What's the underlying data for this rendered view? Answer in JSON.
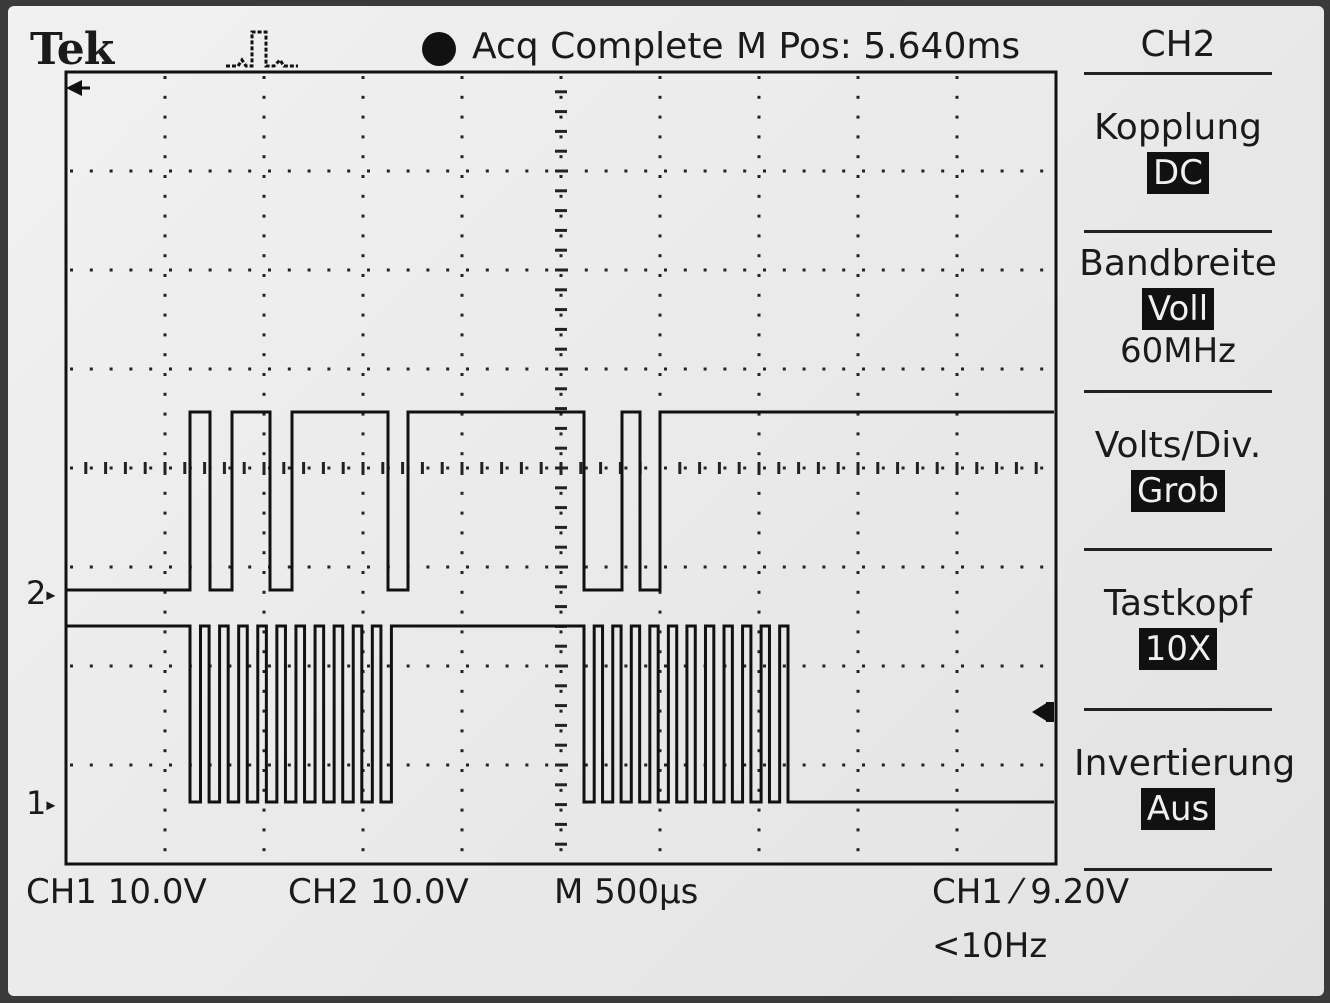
{
  "header": {
    "brand": "Tek",
    "trigger_icon": "pulse-trigger-icon",
    "acq_indicator": "filled-circle-icon",
    "status": "Acq Complete",
    "position": "M Pos: 5.640ms"
  },
  "menu": {
    "title": "CH2",
    "items": [
      {
        "label": "Kopplung",
        "value": "DC"
      },
      {
        "label": "Bandbreite",
        "value": "Voll",
        "sub": "60MHz"
      },
      {
        "label": "Volts/Div.",
        "value": "Grob"
      },
      {
        "label": "Tastkopf",
        "value": "10X"
      },
      {
        "label": "Invertierung",
        "value": "Aus"
      }
    ]
  },
  "markers": {
    "ch1": "1",
    "ch2": "2"
  },
  "readouts": {
    "ch1_scale": "CH1  10.0V",
    "ch2_scale": "CH2  10.0V",
    "timebase": "M 500µs",
    "trigger": "CH1 ⁄ 9.20V",
    "trigger_freq": "<10Hz"
  },
  "colors": {
    "screen_bg": "#ececec",
    "trace": "#111111",
    "highlight_bg": "#111111"
  }
}
